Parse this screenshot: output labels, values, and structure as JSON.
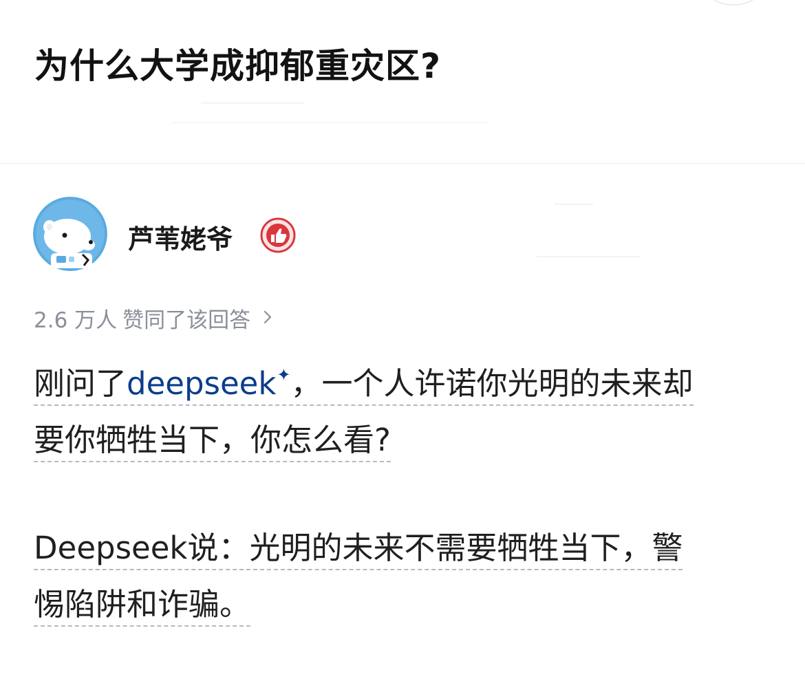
{
  "question": {
    "title": "为什么大学成抑郁重灾区?"
  },
  "author": {
    "name": "芦苇姥爷",
    "avatar_icon": "polar-bear-avatar-icon",
    "badge_icon": "thumbs-up-badge-icon"
  },
  "answer": {
    "vote_count": "2.6 万人",
    "vote_text": "赞同了该回答",
    "vote_chevron_icon": "chevron-right-icon",
    "para1_prefix": "刚问了",
    "para1_link": "deepseek",
    "para1_link_icon": "sparkle-icon",
    "para1_line1_rest": "，一个人许诺你光明的未来却",
    "para1_line2": "要你牺牲当下，你怎么看?",
    "para2_line1": "Deepseek说：光明的未来不需要牺牲当下，警",
    "para2_line2": "惕陷阱和诈骗。"
  },
  "colors": {
    "link": "#0b3d8c",
    "muted": "#8a8f99",
    "badge": "#d9363e",
    "avatar_bg": "#5aaae0"
  }
}
